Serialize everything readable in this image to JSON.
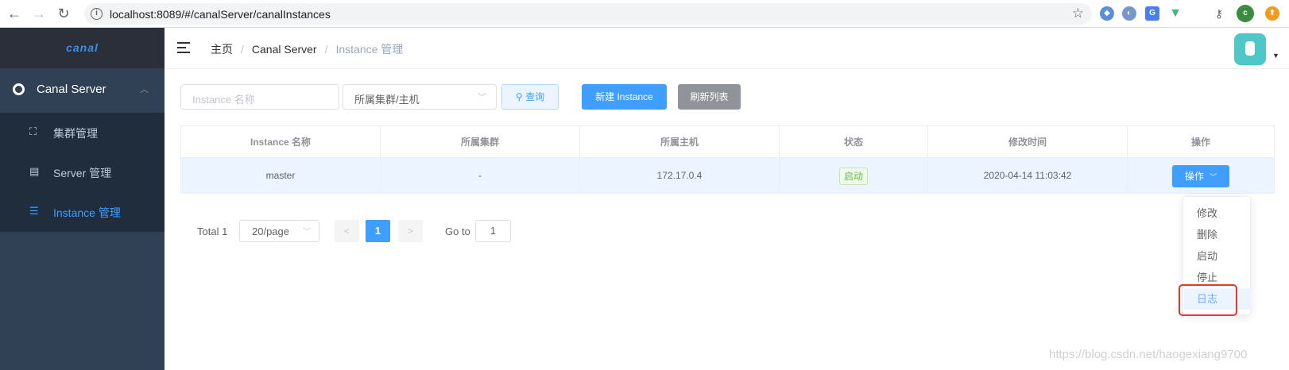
{
  "browser": {
    "url": "localhost:8089/#/canalServer/canalInstances",
    "back_icon": "arrow-left",
    "forward_icon": "arrow-right",
    "reload_icon": "reload",
    "profile_initial": "c"
  },
  "sidebar": {
    "logo": "canal",
    "group_label": "Canal Server",
    "items": [
      {
        "label": "集群管理",
        "icon": "cluster-icon"
      },
      {
        "label": "Server 管理",
        "icon": "document-icon"
      },
      {
        "label": "Instance 管理",
        "icon": "list-icon",
        "active": true
      }
    ]
  },
  "breadcrumb": {
    "home": "主页",
    "section": "Canal Server",
    "current": "Instance 管理"
  },
  "filters": {
    "name_placeholder": "Instance 名称",
    "cluster_select": "所属集群/主机",
    "search_label": "查询",
    "new_label": "新建 Instance",
    "refresh_label": "刷新列表"
  },
  "table": {
    "headers": [
      "Instance 名称",
      "所属集群",
      "所属主机",
      "状态",
      "修改时间",
      "操作"
    ],
    "rows": [
      {
        "name": "master",
        "cluster": "-",
        "host": "172.17.0.4",
        "status": "启动",
        "modified": "2020-04-14 11:03:42",
        "action": "操作"
      }
    ]
  },
  "pagination": {
    "total": "Total 1",
    "page_size": "20/page",
    "prev": "<",
    "current": "1",
    "next": ">",
    "goto_label": "Go to",
    "goto_value": "1"
  },
  "dropdown": {
    "items": [
      "修改",
      "删除",
      "启动",
      "停止",
      "日志"
    ],
    "hovered": "日志"
  },
  "watermark": "https://blog.csdn.net/haogexiang9700",
  "colors": {
    "primary": "#409eff",
    "sidebar_bg": "#304156",
    "submenu_bg": "#1f2d3d",
    "success": "#67c23a",
    "highlight_border": "#e03a2f"
  }
}
